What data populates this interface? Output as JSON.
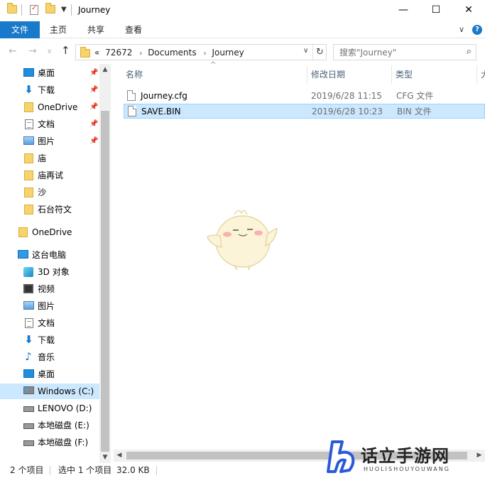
{
  "window": {
    "title": "Journey",
    "minimize": "—",
    "maximize": "☐",
    "close": "✕"
  },
  "ribbon": {
    "tabs": [
      "文件",
      "主页",
      "共享",
      "查看"
    ],
    "expand": "∨",
    "help": "?"
  },
  "nav": {
    "back": "←",
    "forward": "→",
    "recent": "∨",
    "up": "↑",
    "breadcrumb": [
      "«",
      "72672",
      "Documents",
      "Journey"
    ],
    "refresh": "↻",
    "search_placeholder": "搜索\"Journey\""
  },
  "sidebar": {
    "quick_access": [
      {
        "label": "桌面",
        "icon": "desktop-icon",
        "pinned": true
      },
      {
        "label": "下载",
        "icon": "download-icon",
        "pinned": true
      },
      {
        "label": "OneDrive",
        "icon": "folder-icon",
        "pinned": true
      },
      {
        "label": "文档",
        "icon": "document-icon",
        "pinned": true
      },
      {
        "label": "图片",
        "icon": "pictures-icon",
        "pinned": true
      },
      {
        "label": "庙",
        "icon": "folder-icon",
        "pinned": false
      },
      {
        "label": "庙再试",
        "icon": "folder-icon",
        "pinned": false
      },
      {
        "label": "沙",
        "icon": "folder-icon",
        "pinned": false
      },
      {
        "label": "石台符文",
        "icon": "folder-icon",
        "pinned": false
      }
    ],
    "onedrive": "OneDrive",
    "this_pc": "这台电脑",
    "pc_items": [
      {
        "label": "3D 对象",
        "icon": "3d-objects-icon"
      },
      {
        "label": "视频",
        "icon": "video-icon"
      },
      {
        "label": "图片",
        "icon": "pictures-icon"
      },
      {
        "label": "文档",
        "icon": "document-icon"
      },
      {
        "label": "下载",
        "icon": "download-icon"
      },
      {
        "label": "音乐",
        "icon": "music-icon"
      },
      {
        "label": "桌面",
        "icon": "desktop-icon"
      },
      {
        "label": "Windows (C:)",
        "icon": "windows-drive-icon",
        "selected": true
      },
      {
        "label": "LENOVO (D:)",
        "icon": "drive-icon"
      },
      {
        "label": "本地磁盘 (E:)",
        "icon": "drive-icon"
      },
      {
        "label": "本地磁盘 (F:)",
        "icon": "drive-icon"
      }
    ]
  },
  "columns": {
    "name": "名称",
    "date": "修改日期",
    "type": "类型",
    "size": "大"
  },
  "files": [
    {
      "name": "Journey.cfg",
      "date": "2019/6/28 11:15",
      "type": "CFG 文件",
      "selected": false
    },
    {
      "name": "SAVE.BIN",
      "date": "2019/6/28 10:23",
      "type": "BIN 文件",
      "selected": true
    }
  ],
  "status": {
    "count": "2 个项目",
    "selected": "选中 1 个项目",
    "size": "32.0 KB"
  },
  "watermark": {
    "name": "话立手游网",
    "sub": "HUOLISHOUYOUWANG"
  },
  "colors": {
    "accent": "#1979ca",
    "selection": "#cce8ff"
  }
}
